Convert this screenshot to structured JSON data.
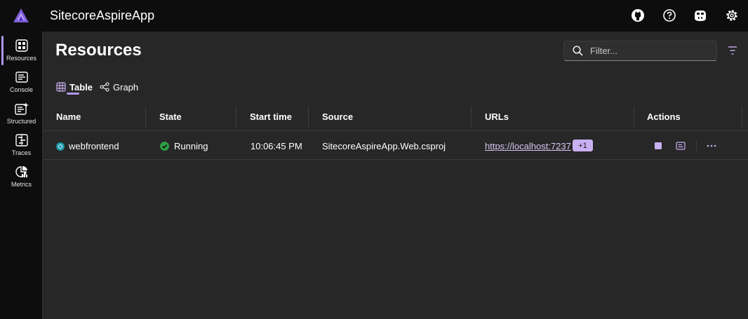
{
  "app": {
    "title": "SitecoreAspireApp"
  },
  "colors": {
    "accent": "#b097e6",
    "running": "#2ea043",
    "badge": "#c9b0f2"
  },
  "top_icons": [
    "github-icon",
    "help-icon",
    "copilot-icon",
    "settings-icon"
  ],
  "sidebar": {
    "items": [
      {
        "label": "Resources",
        "icon": "resources-icon",
        "active": true
      },
      {
        "label": "Console",
        "icon": "console-icon",
        "active": false
      },
      {
        "label": "Structured",
        "icon": "structured-logs-icon",
        "active": false
      },
      {
        "label": "Traces",
        "icon": "traces-icon",
        "active": false
      },
      {
        "label": "Metrics",
        "icon": "metrics-icon",
        "active": false
      }
    ]
  },
  "main": {
    "title": "Resources",
    "filter": {
      "placeholder": "Filter...",
      "value": ""
    },
    "tabs": [
      {
        "label": "Table",
        "icon": "table-icon",
        "active": true
      },
      {
        "label": "Graph",
        "icon": "graph-icon",
        "active": false
      }
    ],
    "table": {
      "columns": [
        "Name",
        "State",
        "Start time",
        "Source",
        "URLs",
        "Actions"
      ],
      "rows": [
        {
          "name": "webfrontend",
          "state": "Running",
          "start_time": "10:06:45 PM",
          "source": "SitecoreAspireApp.Web.csproj",
          "url": "https://localhost:7237",
          "url_extra": "+1"
        }
      ]
    }
  }
}
